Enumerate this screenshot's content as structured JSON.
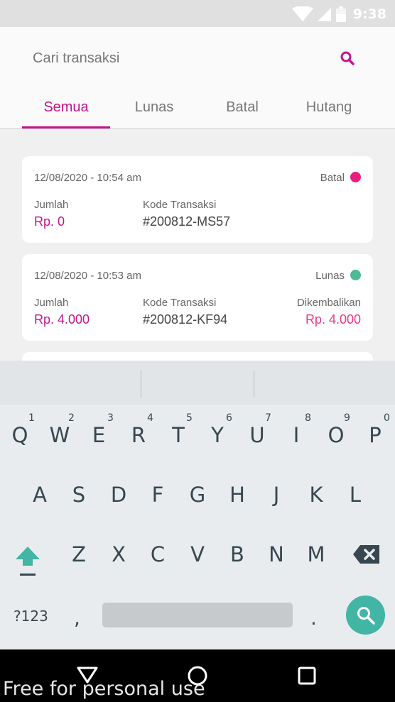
{
  "status_bar": {
    "time": "9:38",
    "icons": [
      "wifi-icon",
      "signal-icon",
      "battery-icon"
    ]
  },
  "search": {
    "placeholder": "Cari transaksi",
    "icon": "search-icon"
  },
  "tabs": [
    {
      "label": "Semua",
      "active": true
    },
    {
      "label": "Lunas",
      "active": false
    },
    {
      "label": "Batal",
      "active": false
    },
    {
      "label": "Hutang",
      "active": false
    }
  ],
  "transactions": [
    {
      "datetime": "12/08/2020 - 10:54 am",
      "status": "Batal",
      "status_color": "#e91e7c",
      "amount_label": "Jumlah",
      "amount": "Rp. 0",
      "code_label": "Kode Transaksi",
      "code": "#200812-MS57"
    },
    {
      "datetime": "12/08/2020 - 10:53 am",
      "status": "Lunas",
      "status_color": "#4cba94",
      "amount_label": "Jumlah",
      "amount": "Rp. 4.000",
      "code_label": "Kode Transaksi",
      "code": "#200812-KF94",
      "refund_label": "Dikembalikan",
      "refund": "Rp. 4.000"
    }
  ],
  "keyboard": {
    "row1": [
      "Q",
      "W",
      "E",
      "R",
      "T",
      "Y",
      "U",
      "I",
      "O",
      "P"
    ],
    "row1_numbers": [
      "1",
      "2",
      "3",
      "4",
      "5",
      "6",
      "7",
      "8",
      "9",
      "0"
    ],
    "row2": [
      "A",
      "S",
      "D",
      "F",
      "G",
      "H",
      "J",
      "K",
      "L"
    ],
    "row3": [
      "Z",
      "X",
      "C",
      "V",
      "B",
      "N",
      "M"
    ],
    "symbols_label": "?123",
    "comma": ",",
    "period": ".",
    "accent_color": "#43b5a4"
  },
  "watermark": "Free for personal use",
  "colors": {
    "brand": "#c5148c",
    "refund": "#e83a84"
  }
}
